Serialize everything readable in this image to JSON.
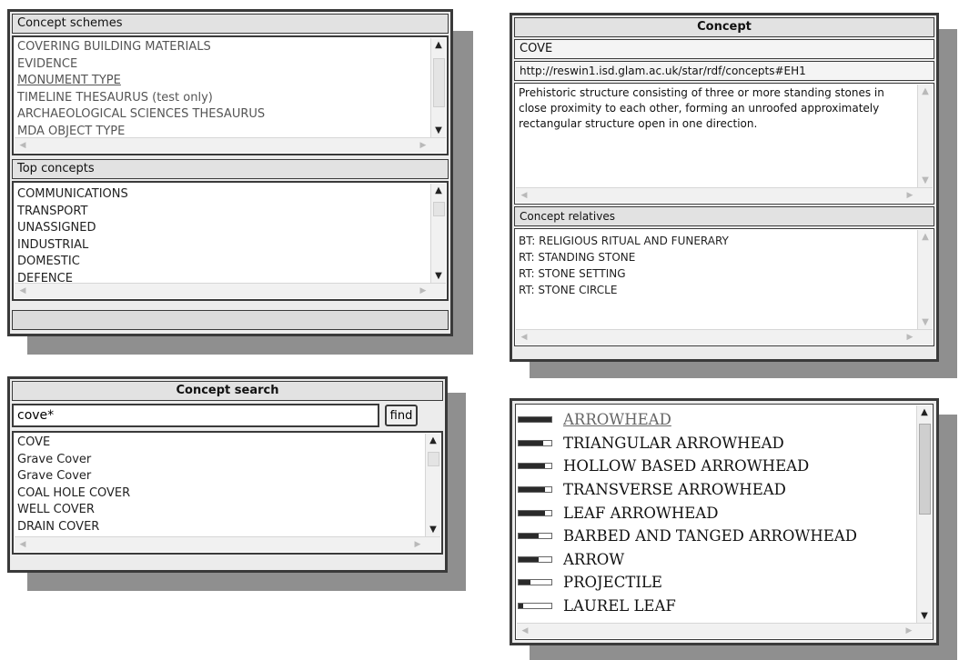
{
  "schemes_panel": {
    "header": "Concept schemes",
    "items": [
      "COVERING BUILDING MATERIALS",
      "EVIDENCE",
      "MONUMENT TYPE",
      "TIMELINE THESAURUS (test only)",
      "ARCHAEOLOGICAL SCIENCES THESAURUS",
      "MDA OBJECT TYPE"
    ]
  },
  "top_concepts_panel": {
    "header": "Top concepts",
    "items": [
      "COMMUNICATIONS",
      "TRANSPORT",
      "UNASSIGNED",
      "INDUSTRIAL",
      "DOMESTIC",
      "DEFENCE"
    ]
  },
  "concept_panel": {
    "header": "Concept",
    "label": "COVE",
    "uri": "http://reswin1.isd.glam.ac.uk/star/rdf/concepts#EH1",
    "description": "Prehistoric structure consisting of three or more standing stones in close proximity to each other, forming an unroofed approximately rectangular structure open in one direction.",
    "relatives_header": "Concept relatives",
    "relatives": [
      "BT: RELIGIOUS RITUAL AND FUNERARY",
      "RT: STANDING STONE",
      "RT: STONE SETTING",
      "RT: STONE CIRCLE"
    ]
  },
  "search_panel": {
    "header": "Concept search",
    "query": "cove*",
    "find_label": "find",
    "results": [
      "COVE",
      "Grave Cover",
      "Grave Cover",
      "COAL HOLE COVER",
      "WELL COVER",
      "DRAIN COVER"
    ]
  },
  "ranked_panel": {
    "items": [
      {
        "label": "ARROWHEAD",
        "score": 1.0
      },
      {
        "label": "TRIANGULAR ARROWHEAD",
        "score": 0.75
      },
      {
        "label": "HOLLOW BASED ARROWHEAD",
        "score": 0.8
      },
      {
        "label": "TRANSVERSE ARROWHEAD",
        "score": 0.8
      },
      {
        "label": "LEAF ARROWHEAD",
        "score": 0.8
      },
      {
        "label": "BARBED AND TANGED ARROWHEAD",
        "score": 0.6
      },
      {
        "label": "ARROW",
        "score": 0.6
      },
      {
        "label": "PROJECTILE",
        "score": 0.35
      },
      {
        "label": "LAUREL LEAF",
        "score": 0.15
      }
    ]
  },
  "icons": {
    "up": "scroll-up-arrow",
    "down": "scroll-down-arrow",
    "left": "scroll-left-arrow",
    "right": "scroll-right-arrow"
  }
}
